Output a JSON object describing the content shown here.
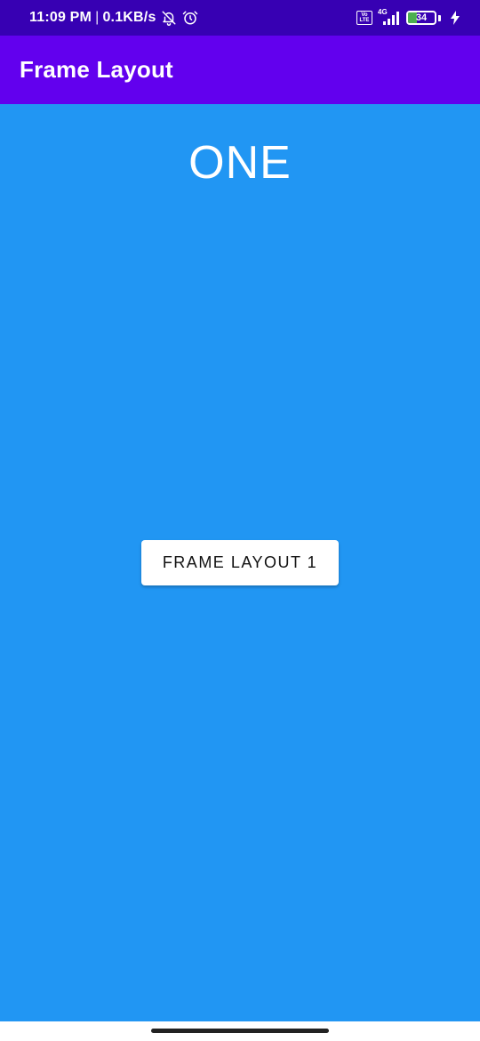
{
  "status_bar": {
    "time": "11:09 PM",
    "separator": "|",
    "network_speed": "0.1KB/s",
    "icons_left": [
      "notifications-off-icon",
      "alarm-icon"
    ],
    "volte_top": "Vo",
    "volte_bottom": "LTE",
    "network_type": "4G",
    "battery_percent": "34",
    "battery_level": 0.34,
    "charging": true
  },
  "app_bar": {
    "title": "Frame Layout"
  },
  "content": {
    "label": "ONE",
    "button_label": "FRAME LAYOUT 1"
  },
  "colors": {
    "status_bar": "#3700B3",
    "app_bar": "#6200EE",
    "content_background": "#2196F3",
    "button_background": "#FFFFFF"
  }
}
